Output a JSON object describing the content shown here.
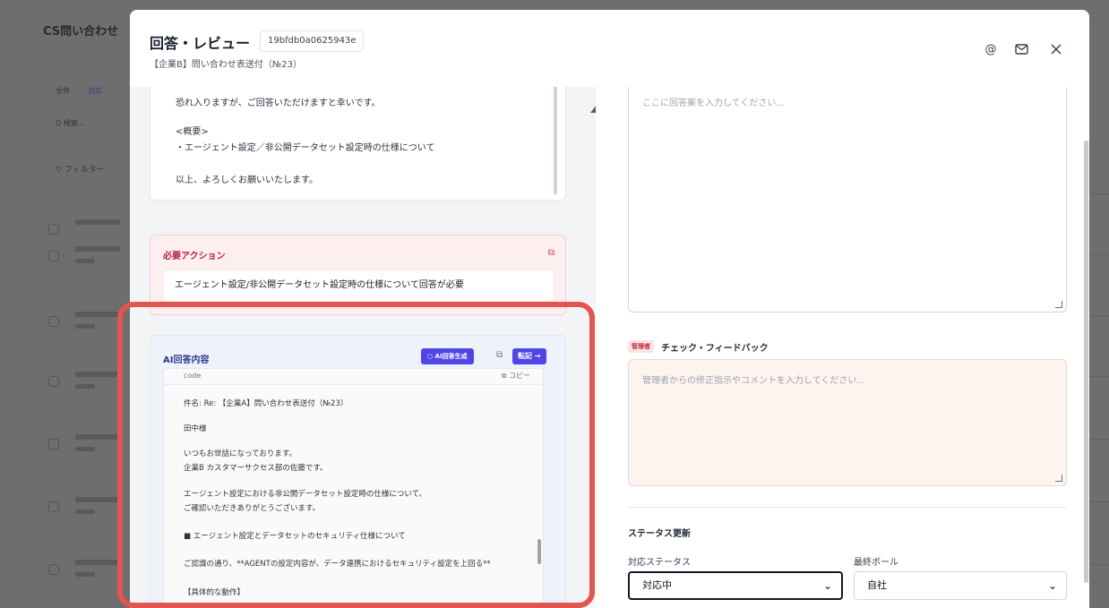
{
  "background": {
    "title": "CS問い合わせ",
    "tabs": [
      "全件",
      "対応"
    ],
    "search": "Q 検索...",
    "filter": "▽ フィルター"
  },
  "modal": {
    "title": "回答・レビュー",
    "id": "19bfdb0a0625943e",
    "subtitle": "【企業B】問い合わせ表送付（№23）",
    "header_icons": [
      "at-icon",
      "mail-icon",
      "close-icon"
    ]
  },
  "email": {
    "lines": [
      "恐れ入りますが、ご回答いただけますと幸いです。",
      "<概要>",
      "・エージェント設定／非公開データセット設定時の仕様について",
      "以上、よろしくお願いいたします。"
    ]
  },
  "action": {
    "title": "必要アクション",
    "text": "エージェント設定/非公開データセット設定時の仕様について回答が必要"
  },
  "ai": {
    "title": "AI回答内容",
    "generate_label": "AI回答生成",
    "post_label": "転記 →",
    "code_lang": "code",
    "code_copy": "コピー",
    "lines": [
      "件名: Re: 【企業A】問い合わせ表送付（№23）",
      "田中様",
      "いつもお世話になっております。",
      "企業B カスタマーサクセス部の佐藤です。",
      "エージェント設定における非公開データセット設定時の仕様について、",
      "ご確認いただきありがとうございます。",
      "■ エージェント設定とデータセットのセキュリティ仕様について",
      "ご認識の通り、**AGENTの設定内容が、データ連携におけるセキュリティ設定を上回る**",
      "【具体的な動作】"
    ]
  },
  "answer": {
    "placeholder": "ここに回答案を入力してください..."
  },
  "feedback": {
    "badge": "管理者",
    "title": "チェック・フィードバック",
    "placeholder": "管理者からの修正指示やコメントを入力してください..."
  },
  "status": {
    "title": "ステータス更新",
    "status_label": "対応ステータス",
    "status_value": "対応中",
    "ball_label": "最終ボール",
    "ball_value": "自社"
  },
  "colors": {
    "accent": "#4f46e5",
    "danger": "#b4233b",
    "highlight": "#e25550"
  }
}
